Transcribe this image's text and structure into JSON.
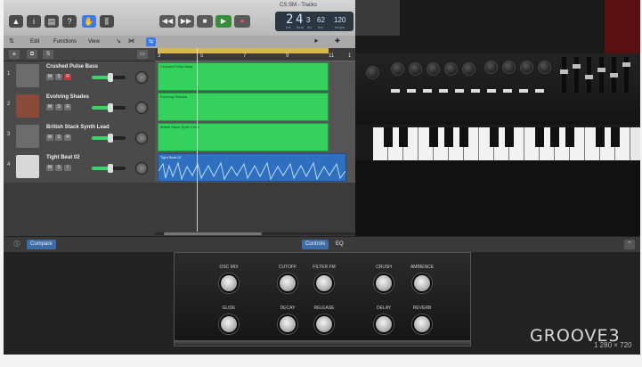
{
  "window": {
    "title": "CS.SM - Tracks"
  },
  "lcd": {
    "bar": "2",
    "beat": "4",
    "div": "3",
    "tick": "62",
    "tempo": "120",
    "bar_label": "bar",
    "beat_label": "beat",
    "div_label": "div",
    "tick_label": "tick",
    "tempo_label": "tempo"
  },
  "toolbar2": {
    "edit": "Edit",
    "functions": "Functions",
    "view": "View"
  },
  "tracks": [
    {
      "num": "1",
      "name": "Crushed Pulse Bass",
      "region": "Crushed Pulse Bass"
    },
    {
      "num": "2",
      "name": "Evolving Shades",
      "region": "Evolving Shades"
    },
    {
      "num": "3",
      "name": "British Stack Synth Lead",
      "region": "British Stack Synth Lead"
    },
    {
      "num": "4",
      "name": "Tight Beat 02",
      "region": "Tight Beat 02"
    }
  ],
  "mute": "M",
  "solo": "S",
  "rec": "R",
  "input": "I",
  "ruler": [
    "3",
    "5",
    "7",
    "9",
    "11"
  ],
  "ruler_extra": "1",
  "plugin": {
    "compare": "Compare",
    "controls": "Controls",
    "eq": "EQ"
  },
  "knobs_top": [
    "OSC MIX",
    "CUTOFF",
    "FILTER FM",
    "CRUSH",
    "AMBIENCE"
  ],
  "knobs_bottom": [
    "GLIDE",
    "DECAY",
    "RELEASE",
    "DELAY",
    "REVERB"
  ],
  "logo": "GROOVE3",
  "dims": "1 280 × 720",
  "colors": {
    "region_green": "#34d15c",
    "audio_blue": "#2f6fbf",
    "cycle_yellow": "#d8b84a"
  }
}
